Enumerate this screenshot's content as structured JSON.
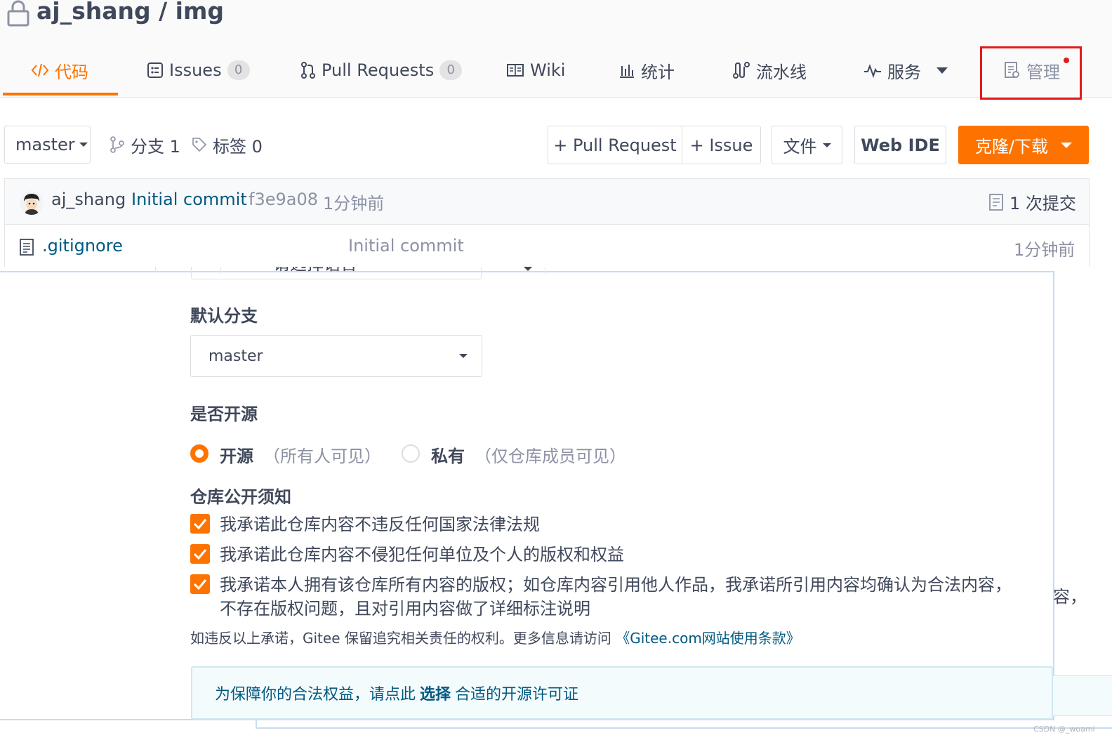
{
  "repo": {
    "owner": "aj_shang",
    "separator": "/",
    "name": "img"
  },
  "tabs": [
    {
      "label": "代码",
      "icon": "code-icon"
    },
    {
      "label": "Issues",
      "count": "0",
      "icon": "issues-icon"
    },
    {
      "label": "Pull Requests",
      "count": "0",
      "icon": "pull-request-icon"
    },
    {
      "label": "Wiki",
      "icon": "book-icon"
    },
    {
      "label": "统计",
      "icon": "bar-chart-icon"
    },
    {
      "label": "流水线",
      "icon": "pipeline-icon"
    },
    {
      "label": "服务",
      "icon": "pulse-icon"
    },
    {
      "label": "管理",
      "icon": "manage-icon"
    }
  ],
  "toolbar": {
    "branch": "master",
    "branches_label": "分支 1",
    "tags_label": "标签 0",
    "pull_request_btn": "+ Pull Request",
    "issue_btn": "+ Issue",
    "file_btn": "文件",
    "web_ide_btn": "Web IDE",
    "clone_btn": "克隆/下载"
  },
  "commit": {
    "author": "aj_shang",
    "message": "Initial commit",
    "hash": "f3e9a08",
    "time": "1分钟前",
    "count_label": "1 次提交"
  },
  "files": [
    {
      "name": ".gitignore",
      "commit": "Initial commit",
      "time": "1分钟前"
    }
  ],
  "settings": {
    "lang_cut_text": "请选择语言",
    "default_branch_label": "默认分支",
    "default_branch_value": "master",
    "open_source_label": "是否开源",
    "open_option": "开源",
    "open_option_hint": "（所有人可见）",
    "private_option": "私有",
    "private_option_hint": "（仅仓库成员可见）",
    "notice_label": "仓库公开须知",
    "pledges": [
      "我承诺此仓库内容不违反任何国家法律法规",
      "我承诺此仓库内容不侵犯任何单位及个人的版权和权益",
      "我承诺本人拥有该仓库所有内容的版权；如仓库内容引用他人作品，我承诺所引用内容均确认为合法内容，",
      "不存在版权问题，且对引用内容做了详细标注说明"
    ],
    "overflow_text": "容，",
    "terms_note": "如违反以上承诺，Gitee 保留追究相关责任的权利。更多信息请访问",
    "terms_link": "《Gitee.com网站使用条款》",
    "license_prefix": "为保障你的合法权益，请点此",
    "license_link": "选择",
    "license_suffix": "合适的开源许可证"
  },
  "watermark": "CSDN @_woami",
  "colors": {
    "accent": "#fe7300",
    "link": "#005980",
    "highlight_box": "#e01b1b"
  }
}
